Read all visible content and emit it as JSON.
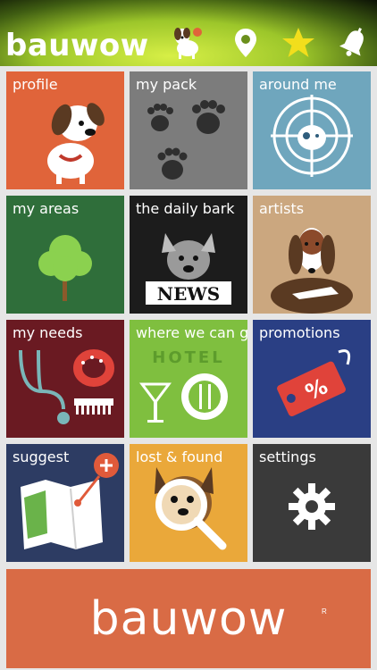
{
  "header": {
    "brand": "bauwow",
    "icons": [
      "dog-mascot-icon",
      "location-pin-icon",
      "star-icon",
      "bell-icon"
    ]
  },
  "tiles": [
    {
      "label": "profile",
      "color": "#e0643a",
      "icon": "dog-icon"
    },
    {
      "label": "my pack",
      "color": "#7c7c7c",
      "icon": "paw-prints-icon"
    },
    {
      "label": "around me",
      "color": "#6fa6bd",
      "icon": "radar-dog-icon"
    },
    {
      "label": "my areas",
      "color": "#2f6e3a",
      "icon": "tree-icon"
    },
    {
      "label": "the daily bark",
      "color": "#1c1c1c",
      "icon": "dog-newspaper-icon"
    },
    {
      "label": "artists",
      "color": "#cba77f",
      "icon": "basset-portrait-icon"
    },
    {
      "label": "my needs",
      "color": "#6a1a22",
      "icon": "stethoscope-collar-comb-icon"
    },
    {
      "label": "where we can go",
      "color": "#7fbf3f",
      "icon": "hotel-dining-icon"
    },
    {
      "label": "promotions",
      "color": "#2a3f84",
      "icon": "price-tags-icon"
    },
    {
      "label": "suggest",
      "color": "#2d3c63",
      "icon": "map-add-icon"
    },
    {
      "label": "lost & found",
      "color": "#eaa83a",
      "icon": "magnifier-dog-icon"
    },
    {
      "label": "settings",
      "color": "#3a3a3a",
      "icon": "gear-icon"
    }
  ],
  "banner": {
    "brand": "bauwow",
    "mark": "R",
    "color": "#d96b45"
  }
}
